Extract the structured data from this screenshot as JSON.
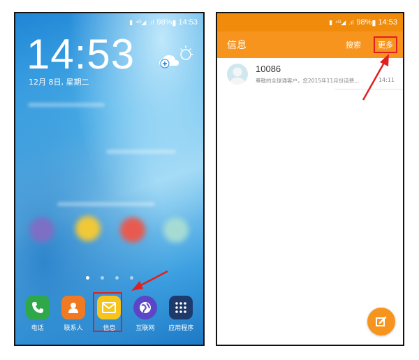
{
  "left_screen": {
    "status": {
      "battery": "98%",
      "time": "14:53"
    },
    "clock": "14:53",
    "date": "12月 8日, 星期二",
    "dock": [
      {
        "label": "电话",
        "icon": "phone-icon",
        "color": "#2fa84a"
      },
      {
        "label": "联系人",
        "icon": "contacts-icon",
        "color": "#f07a22"
      },
      {
        "label": "信息",
        "icon": "message-icon",
        "color": "#f5c51c"
      },
      {
        "label": "互联网",
        "icon": "internet-icon",
        "color": "#5a46c6"
      },
      {
        "label": "应用程序",
        "icon": "apps-grid-icon",
        "color": "#1e3a6b"
      }
    ]
  },
  "right_screen": {
    "status": {
      "battery": "98%",
      "time": "14:53"
    },
    "header": {
      "title": "信息",
      "search": "搜索",
      "more": "更多"
    },
    "messages": [
      {
        "sender": "10086",
        "preview": "尊敬的全球通客户，您2015年11月份话费...",
        "time": "14:11"
      }
    ]
  },
  "colors": {
    "accent": "#f7941d",
    "highlight": "#e02020"
  }
}
